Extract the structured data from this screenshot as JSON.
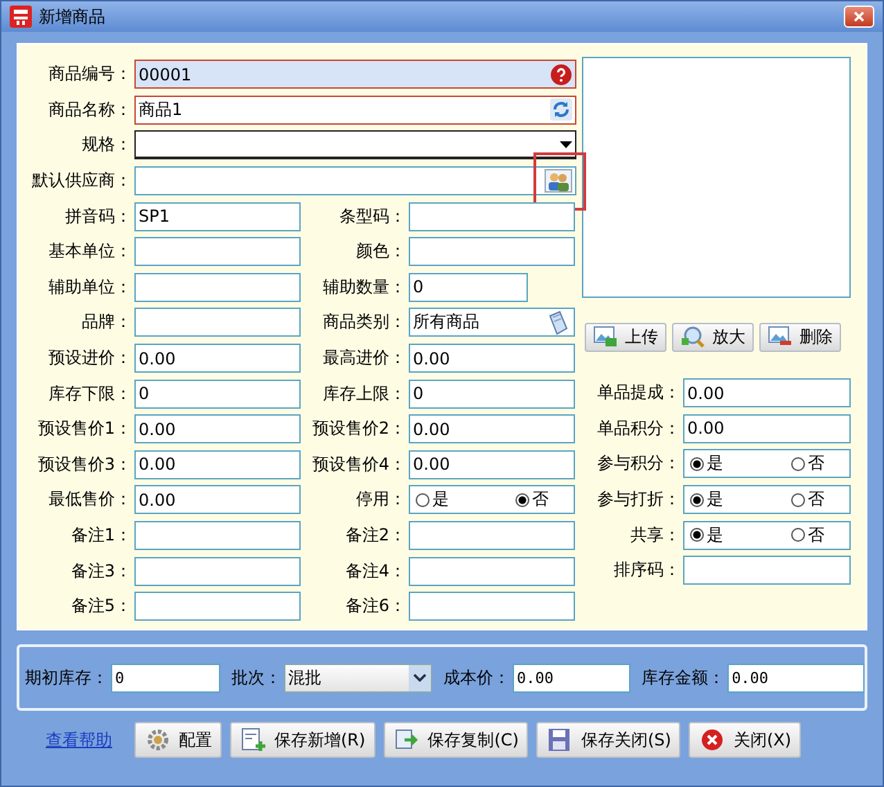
{
  "window": {
    "title": "新增商品"
  },
  "top_fields": [
    {
      "label": "商品编号：",
      "value": "00001",
      "kind": "required"
    },
    {
      "label": "商品名称：",
      "value": "商品1",
      "kind": "refresh"
    },
    {
      "label": "规格：",
      "kind": "dropdown"
    },
    {
      "label": "默认供应商：",
      "kind": "picker",
      "highlighted": true
    }
  ],
  "grid_rows": [
    {
      "left": {
        "label": "拼音码：",
        "value": "SP1"
      },
      "right": {
        "label": "条型码：",
        "kind": "text"
      }
    },
    {
      "left": {
        "label": "基本单位："
      },
      "right": {
        "label": "颜色：",
        "kind": "text"
      }
    },
    {
      "left": {
        "label": "辅助单位："
      },
      "right": {
        "label": "辅助数量：",
        "value": "0",
        "kind": "narrow"
      }
    },
    {
      "left": {
        "label": "品牌："
      },
      "right": {
        "label": "商品类别：",
        "value": "所有商品",
        "kind": "category"
      }
    },
    {
      "left": {
        "label": "预设进价：",
        "value": "0.00"
      },
      "right": {
        "label": "最高进价：",
        "value": "0.00",
        "kind": "text"
      }
    },
    {
      "left": {
        "label": "库存下限：",
        "value": "0"
      },
      "right": {
        "label": "库存上限：",
        "value": "0",
        "kind": "text"
      }
    },
    {
      "left": {
        "label": "预设售价1：",
        "value": "0.00"
      },
      "right": {
        "label": "预设售价2：",
        "value": "0.00",
        "kind": "text"
      }
    },
    {
      "left": {
        "label": "预设售价3：",
        "value": "0.00"
      },
      "right": {
        "label": "预设售价4：",
        "value": "0.00",
        "kind": "text"
      }
    },
    {
      "left": {
        "label": "最低售价：",
        "value": "0.00"
      },
      "right": {
        "label": "停用：",
        "kind": "radio",
        "options": [
          {
            "label": "是",
            "selected": false
          },
          {
            "label": "否",
            "selected": true
          }
        ]
      }
    },
    {
      "left": {
        "label": "备注1："
      },
      "right": {
        "label": "备注2：",
        "kind": "text"
      }
    },
    {
      "left": {
        "label": "备注3："
      },
      "right": {
        "label": "备注4：",
        "kind": "text"
      }
    },
    {
      "left": {
        "label": "备注5："
      },
      "right": {
        "label": "备注6：",
        "kind": "text"
      }
    }
  ],
  "image_buttons": [
    {
      "label": "上传",
      "kind": "upload"
    },
    {
      "label": "放大",
      "kind": "zoom"
    },
    {
      "label": "删除",
      "kind": "delete"
    }
  ],
  "side_fields": [
    {
      "label": "单品提成：",
      "value": "0.00",
      "kind": "text"
    },
    {
      "label": "单品积分：",
      "value": "0.00",
      "kind": "text"
    },
    {
      "label": "参与积分：",
      "kind": "radio",
      "options": [
        {
          "label": "是",
          "selected": true
        },
        {
          "label": "否",
          "selected": false
        }
      ]
    },
    {
      "label": "参与打折：",
      "kind": "radio",
      "options": [
        {
          "label": "是",
          "selected": true
        },
        {
          "label": "否",
          "selected": false
        }
      ]
    },
    {
      "label": "共享：",
      "kind": "radio",
      "options": [
        {
          "label": "是",
          "selected": true
        },
        {
          "label": "否",
          "selected": false
        }
      ]
    },
    {
      "label": "排序码：",
      "kind": "text"
    }
  ],
  "stock_bar": [
    {
      "label": "期初库存：",
      "value": "0",
      "kind": "text"
    },
    {
      "label": "批次：",
      "value": "混批",
      "kind": "dropdown"
    },
    {
      "label": "成本价：",
      "value": "0.00",
      "kind": "text"
    },
    {
      "label": "库存金额：",
      "value": "0.00",
      "kind": "text"
    }
  ],
  "footer": {
    "help_link": "查看帮助",
    "buttons": [
      {
        "label": "配置",
        "kind": "config"
      },
      {
        "label": "保存新增(R)",
        "kind": "save-new"
      },
      {
        "label": "保存复制(C)",
        "kind": "save-copy"
      },
      {
        "label": "保存关闭(S)",
        "kind": "save-close"
      },
      {
        "label": "关闭(X)",
        "kind": "close"
      }
    ]
  }
}
